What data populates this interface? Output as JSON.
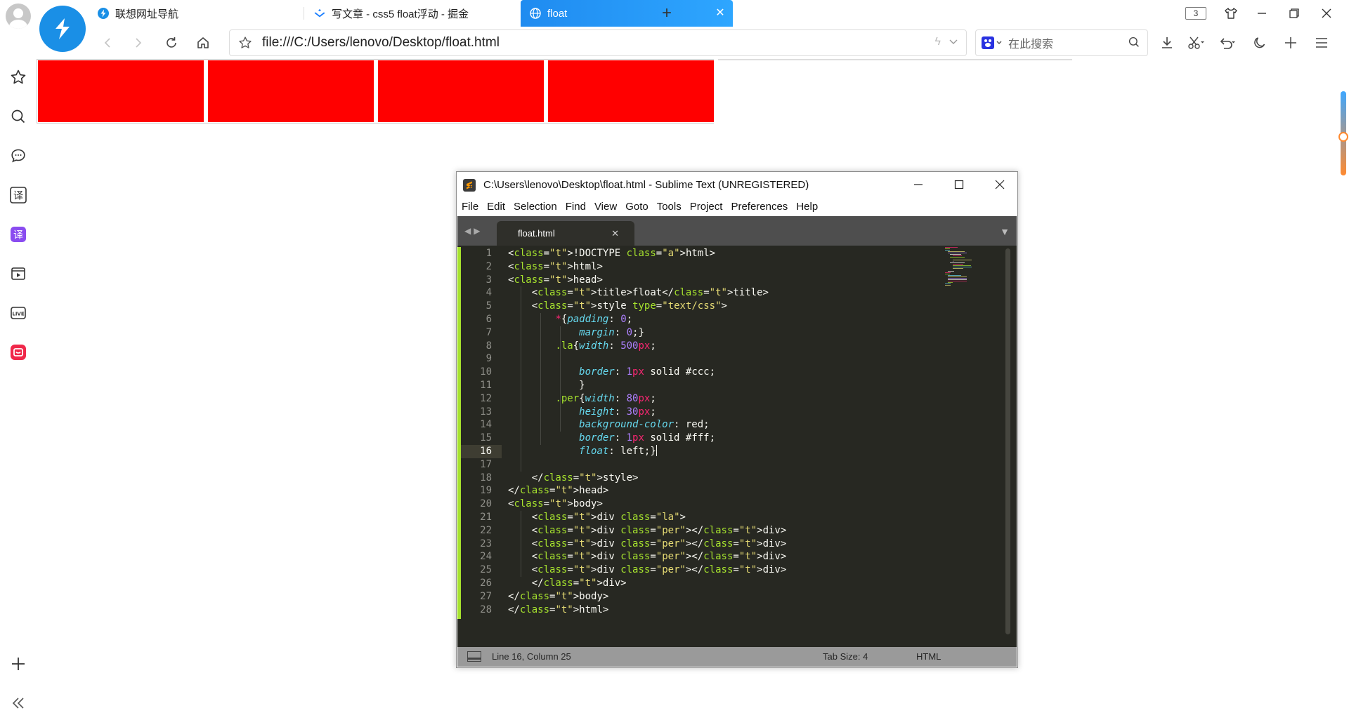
{
  "browser": {
    "tabs": [
      {
        "label": "联想网址导航",
        "active": false
      },
      {
        "label": "写文章 - css5 float浮动 - 掘金",
        "active": false
      },
      {
        "label": "float",
        "active": true
      }
    ],
    "tab_count": "3",
    "address": "file:///C:/Users/lenovo/Desktop/float.html",
    "search_placeholder": "在此搜索"
  },
  "sublime": {
    "title": "C:\\Users\\lenovo\\Desktop\\float.html - Sublime Text (UNREGISTERED)",
    "menu": [
      "File",
      "Edit",
      "Selection",
      "Find",
      "View",
      "Goto",
      "Tools",
      "Project",
      "Preferences",
      "Help"
    ],
    "tab": "float.html",
    "current_line": 16,
    "code": [
      "<!DOCTYPE html>",
      "<html>",
      "<head>",
      "    <title>float</title>",
      "    <style type=\"text/css\">",
      "        *{padding: 0;",
      "            margin: 0;}",
      "        .la{width: 500px;",
      "",
      "            border: 1px solid #ccc;",
      "            }",
      "        .per{width: 80px;",
      "            height: 30px;",
      "            background-color: red;",
      "            border: 1px solid #fff;",
      "            float: left;}",
      "",
      "    </style>",
      "</head>",
      "<body>",
      "    <div class=\"la\">",
      "    <div class=\"per\"></div>",
      "    <div class=\"per\"></div>",
      "    <div class=\"per\"></div>",
      "    <div class=\"per\"></div>",
      "    </div>",
      "</body>",
      "</html>"
    ],
    "status": {
      "position": "Line 16, Column 25",
      "tab_size": "Tab Size: 4",
      "syntax": "HTML"
    }
  },
  "page": {
    "per_color": "#ff0000",
    "per_count": 4
  },
  "colors": {
    "accent": "#1f8bf0",
    "editor_bg": "#272822",
    "status_bg": "#9a9a9a"
  }
}
